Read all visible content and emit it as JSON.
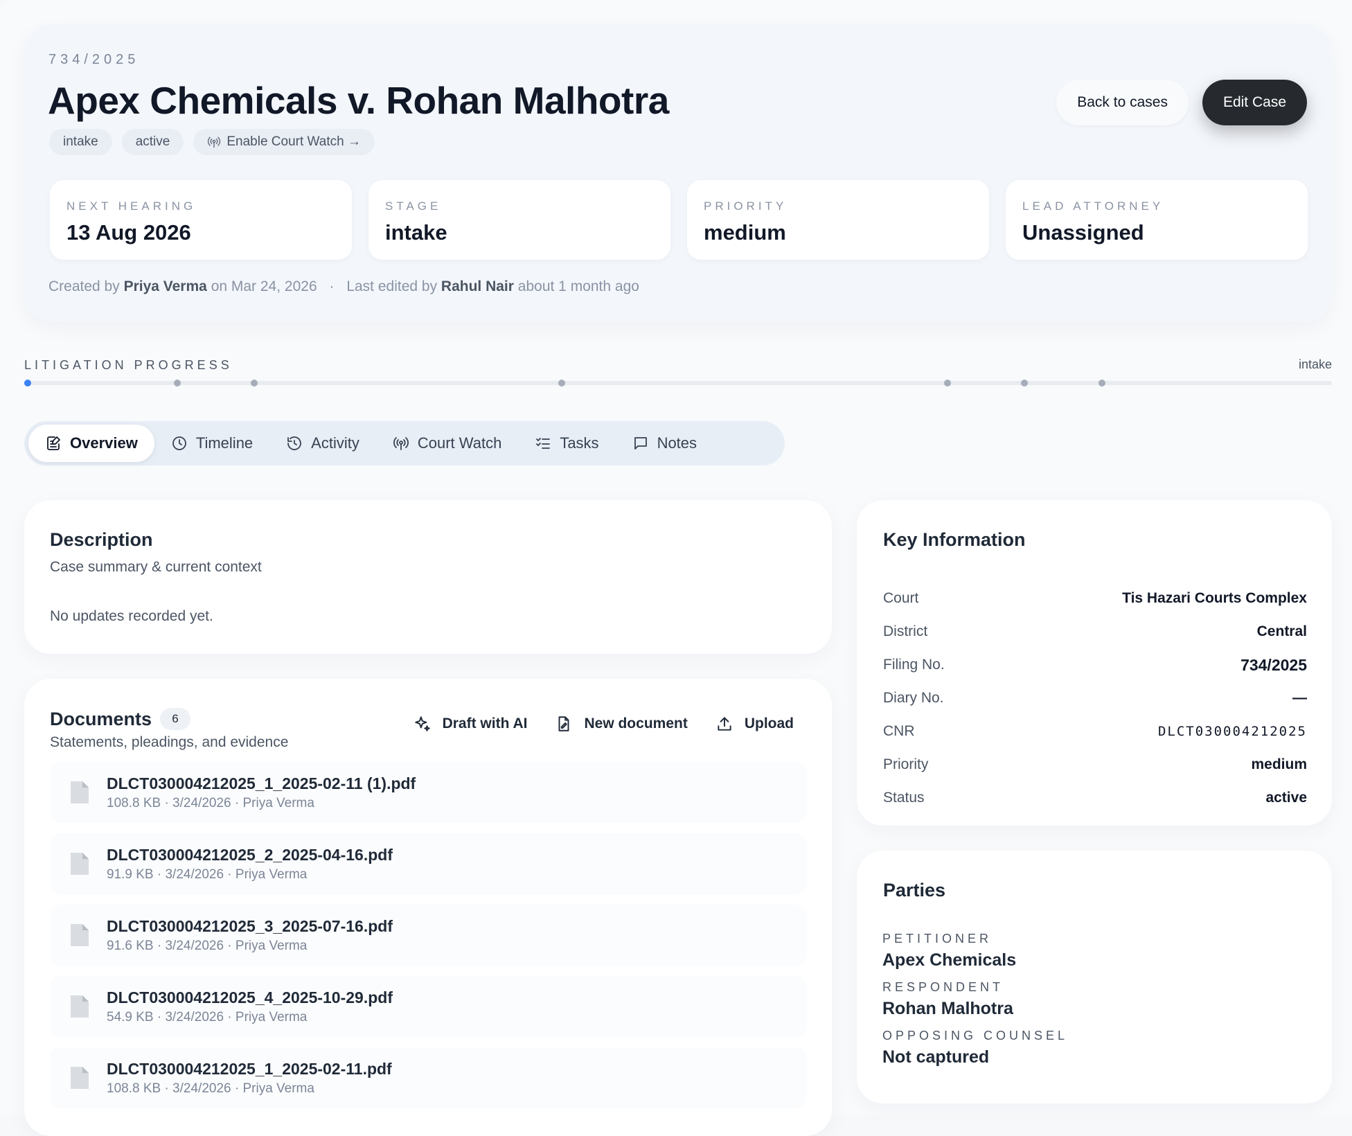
{
  "header": {
    "case_number": "734/2025",
    "title": "Apex Chemicals v. Rohan Malhotra",
    "chips": {
      "stage": "intake",
      "status": "active",
      "court_watch": "Enable Court Watch →"
    },
    "back_label": "Back to cases",
    "edit_label": "Edit Case",
    "stats": [
      {
        "label": "NEXT HEARING",
        "value": "13 Aug 2026"
      },
      {
        "label": "STAGE",
        "value": "intake"
      },
      {
        "label": "PRIORITY",
        "value": "medium"
      },
      {
        "label": "LEAD ATTORNEY",
        "value": "Unassigned"
      }
    ],
    "meta": {
      "created_prefix": "Created by",
      "created_by": "Priya Verma",
      "created_on": "on Mar 24, 2026",
      "separator": "·",
      "edited_prefix": "Last edited by",
      "edited_by": "Rahul Nair",
      "edited_when": "about 1 month ago"
    }
  },
  "progress": {
    "label": "LITIGATION PROGRESS",
    "current_stage": "intake",
    "fraction_complete": 0.002,
    "milestone_fractions": [
      0.0,
      0.117,
      0.176,
      0.411,
      0.706,
      0.765,
      0.824
    ]
  },
  "tabs": [
    {
      "label": "Overview",
      "icon": "overview-icon",
      "active": true
    },
    {
      "label": "Timeline",
      "icon": "clock-icon",
      "active": false
    },
    {
      "label": "Activity",
      "icon": "history-icon",
      "active": false
    },
    {
      "label": "Court Watch",
      "icon": "broadcast-icon",
      "active": false
    },
    {
      "label": "Tasks",
      "icon": "checklist-icon",
      "active": false
    },
    {
      "label": "Notes",
      "icon": "message-icon",
      "active": false
    }
  ],
  "description": {
    "title": "Description",
    "subtitle": "Case summary & current context",
    "body": "No updates recorded yet."
  },
  "documents": {
    "title": "Documents",
    "count": "6",
    "subtitle": "Statements, pleadings, and evidence",
    "actions": {
      "draft": "Draft with AI",
      "new": "New document",
      "upload": "Upload"
    },
    "items": [
      {
        "name": "DLCT030004212025_1_2025-02-11 (1).pdf",
        "meta": "108.8 KB · 3/24/2026 · Priya Verma"
      },
      {
        "name": "DLCT030004212025_2_2025-04-16.pdf",
        "meta": "91.9 KB · 3/24/2026 · Priya Verma"
      },
      {
        "name": "DLCT030004212025_3_2025-07-16.pdf",
        "meta": "91.6 KB · 3/24/2026 · Priya Verma"
      },
      {
        "name": "DLCT030004212025_4_2025-10-29.pdf",
        "meta": "54.9 KB · 3/24/2026 · Priya Verma"
      },
      {
        "name": "DLCT030004212025_1_2025-02-11.pdf",
        "meta": "108.8 KB · 3/24/2026 · Priya Verma"
      }
    ]
  },
  "key_info": {
    "title": "Key Information",
    "rows": [
      {
        "key": "Court",
        "value": "Tis Hazari Courts Complex"
      },
      {
        "key": "District",
        "value": "Central"
      },
      {
        "key": "Filing No.",
        "value": "734/2025"
      },
      {
        "key": "Diary No.",
        "value": "—"
      },
      {
        "key": "CNR",
        "value": "DLCT030004212025"
      },
      {
        "key": "Priority",
        "value": "medium"
      },
      {
        "key": "Status",
        "value": "active"
      }
    ]
  },
  "parties": {
    "title": "Parties",
    "items": [
      {
        "label": "PETITIONER",
        "value": "Apex Chemicals"
      },
      {
        "label": "RESPONDENT",
        "value": "Rohan Malhotra"
      },
      {
        "label": "OPPOSING COUNSEL",
        "value": "Not captured"
      }
    ]
  },
  "colors": {
    "accent": "#3b82f6",
    "dark_button": "#262a2f",
    "page_bg": "#f8fafc",
    "header_bg": "#f3f6fb"
  }
}
